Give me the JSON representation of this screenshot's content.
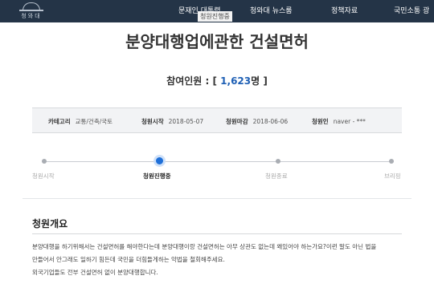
{
  "header": {
    "logo_text": "청와대",
    "nav": [
      "문재인 대통령",
      "청와대 뉴스룸",
      "정책자료",
      "국민소통 광"
    ],
    "sub_label": "청원진행중"
  },
  "petition": {
    "title": "분양대행업에관한 건설면허",
    "participants_label": "참여인원 : [",
    "participants_value": "1,623",
    "participants_suffix": "명 ]",
    "info": {
      "category_label": "카테고리",
      "category_value": "교통/건축/국토",
      "start_label": "청원시작",
      "start_value": "2018-05-07",
      "end_label": "청원마감",
      "end_value": "2018-06-06",
      "author_label": "청원인",
      "author_value": "naver - ***"
    }
  },
  "progress": {
    "steps": [
      "청원시작",
      "청원진행중",
      "청원종료",
      "브리핑"
    ],
    "active_index": 1
  },
  "summary": {
    "heading": "청원개요",
    "lines": [
      "분양대행을 하기위해서는 건설면허를 해야한다는데 분양대행이랑 건설면허는 아무 상관도 없는데 왜있어야 하는가요?이런 말도 아닌 법을",
      "만들어서 안그래도 일하기 힘든데 국민을 더힘들게하는 악법을 철회해주세요.",
      "외국기업들도 전부 건설면허 없이 분양대행합니다."
    ]
  }
}
